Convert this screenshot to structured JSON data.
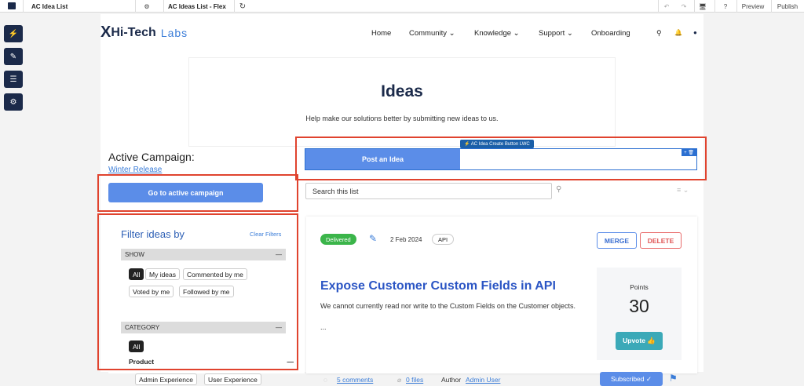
{
  "builder": {
    "page_name": "AC Idea List",
    "gear": "⚙",
    "view_name": "AC Ideas List - Flex",
    "refresh": "↻",
    "undo": "↶",
    "redo": "↷",
    "device": "🖥",
    "help": "?",
    "preview_label": "Preview",
    "publish_label": "Publish",
    "rail_icons": [
      "⚡",
      "✎",
      "☰",
      "⚙"
    ]
  },
  "site": {
    "logo_mark": "X",
    "logo_name": "Hi-Tech",
    "logo_sub": "Labs",
    "nav": [
      "Home",
      "Community ⌄",
      "Knowledge ⌄",
      "Support ⌄",
      "Onboarding"
    ],
    "search_icon": "⚲",
    "bell_icon": "🔔",
    "avatar_icon": "●"
  },
  "ideas_header": {
    "title": "Ideas",
    "subtitle": "Help make our solutions better by submitting new ideas to us."
  },
  "campaign": {
    "label": "Active Campaign:",
    "link": "Winter Release",
    "button": "Go to active campaign"
  },
  "lwc": {
    "tag": "⚡ AC Idea Create Button LWC",
    "tools": "+ 🗑",
    "post_button": "Post an Idea"
  },
  "list": {
    "search_placeholder": "Search this list",
    "search_icon": "⚲",
    "sort_icon": "≡ ⌄"
  },
  "filters": {
    "title": "Filter ideas by",
    "clear": "Clear Filters",
    "show_label": "SHOW",
    "show_collapse": "—",
    "show_options": [
      "All",
      "My ideas",
      "Commented by me",
      "Voted by me",
      "Followed by me"
    ],
    "category_label": "CATEGORY",
    "category_collapse": "—",
    "category_all": "All",
    "product_label": "Product",
    "product_collapse": "—",
    "product_options": [
      "Admin Experience",
      "User Experience"
    ]
  },
  "idea": {
    "status": "Delivered",
    "edit_icon": "✎",
    "date": "2 Feb 2024",
    "tag": "API",
    "merge": "MERGE",
    "delete": "DELETE",
    "title": "Expose Customer Custom Fields in API",
    "description": "We cannot currently read nor write to the Custom Fields on the Customer objects.",
    "ellipsis": "...",
    "points_label": "Points",
    "points": "30",
    "upvote": "Upvote 👍",
    "comments_icon": "◌",
    "comments": "5 comments",
    "files_icon": "⌀",
    "files": "0 files",
    "author_label": "Author",
    "author": "Admin User",
    "subscribed": "Subscribed ✓",
    "flag_icon": "⚑"
  }
}
